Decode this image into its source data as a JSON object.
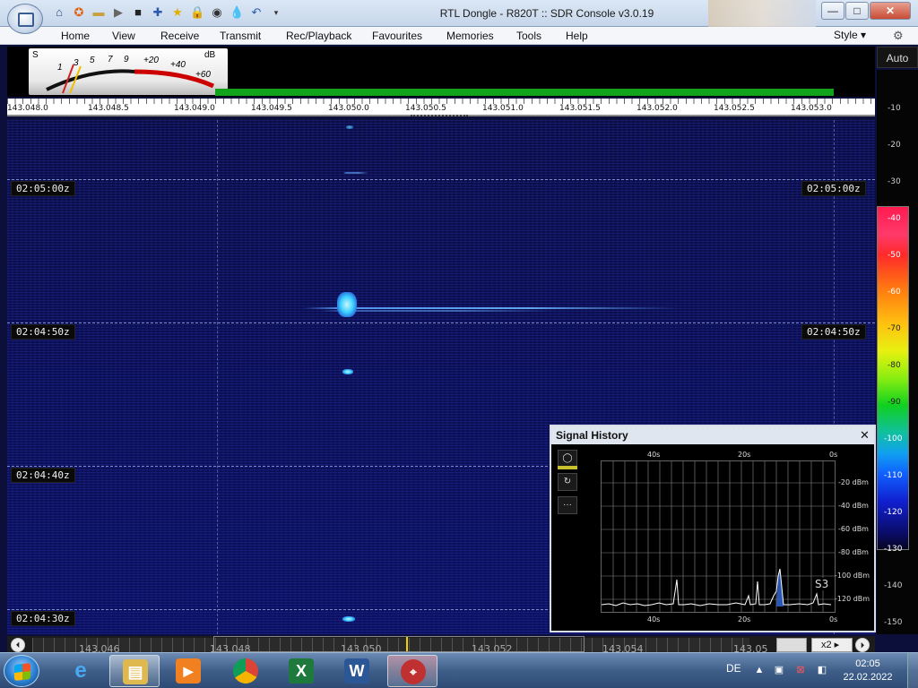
{
  "window": {
    "title": "RTL Dongle - R820T :: SDR Console v3.0.19",
    "minimize": "—",
    "maximize": "□",
    "close": "✕"
  },
  "quick_access": [
    "home-icon",
    "lifebuoy-icon",
    "folder-icon",
    "play-icon",
    "stop-icon",
    "plus-icon",
    "star-icon",
    "lock-icon",
    "camera-icon",
    "drop-icon",
    "undo-icon",
    "dropdown-icon"
  ],
  "menu": {
    "items": [
      "Home",
      "View",
      "Receive",
      "Transmit",
      "Rec/Playback",
      "Favourites",
      "Memories",
      "Tools",
      "Help"
    ],
    "style_label": "Style"
  },
  "smeter": {
    "s_label": "S",
    "db_label": "dB",
    "scale_s": [
      "1",
      "3",
      "5",
      "7",
      "9"
    ],
    "scale_db": [
      "+20",
      "+40",
      "+60"
    ]
  },
  "auto_label": "Auto",
  "frequency_scale": [
    "143.048.0",
    "143.048.5",
    "143.049.0",
    "143.049.5",
    "143.050.0",
    "143.050.5",
    "143.051.0",
    "143.051.5",
    "143.052.0",
    "143.052.5",
    "143.053.0"
  ],
  "waterfall": {
    "time_labels_left": [
      "02:05:00z",
      "02:04:50z",
      "02:04:40z",
      "02:04:30z"
    ],
    "time_labels_right": [
      "02:05:00z",
      "02:04:50z"
    ]
  },
  "db_scale": {
    "ticks": [
      "-10",
      "-20",
      "-30",
      "-40",
      "-50",
      "-60",
      "-70",
      "-80",
      "-90",
      "-100",
      "-110",
      "-120",
      "-130",
      "-140",
      "-150"
    ]
  },
  "signal_history": {
    "title": "Signal History",
    "close": "✕",
    "tools": [
      "circle-icon",
      "refresh-icon",
      "more-icon"
    ],
    "more_label": "···",
    "x_ticks_top": [
      "40s",
      "20s",
      "0s"
    ],
    "x_ticks_bottom": [
      "40s",
      "20s",
      "0s"
    ],
    "y_ticks": [
      "-20 dBm",
      "-40 dBm",
      "-60 dBm",
      "-80 dBm",
      "-100 dBm",
      "-120 dBm"
    ],
    "s_reading": "S3"
  },
  "bottom_bar": {
    "frequencies": [
      "143.046",
      "143.048",
      "143.050",
      "143.052",
      "143.054",
      "143.05"
    ],
    "zoom": "x2"
  },
  "taskbar": {
    "apps": [
      "ie-icon",
      "explorer-icon",
      "media-player-icon",
      "chrome-icon",
      "excel-icon",
      "word-icon",
      "sdr-console-icon"
    ],
    "language": "DE",
    "time": "02:05",
    "date": "22.02.2022"
  },
  "colors": {
    "waterfall_bg": "#0a0e52",
    "spectrum_green": "#12a31d",
    "signal_blue": "#3bd0ff"
  }
}
